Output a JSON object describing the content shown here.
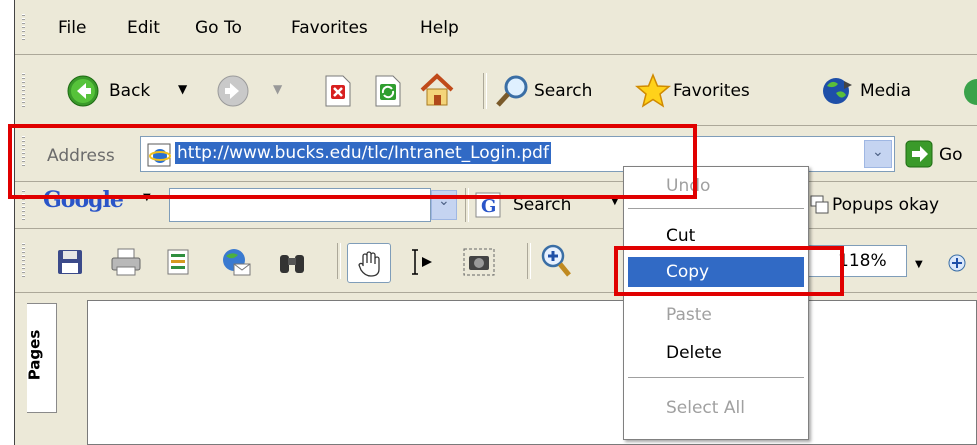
{
  "menubar": {
    "items": [
      {
        "label": "File"
      },
      {
        "label": "Edit"
      },
      {
        "label": "Go To"
      },
      {
        "label": "Favorites"
      },
      {
        "label": "Help"
      }
    ]
  },
  "toolbar": {
    "back_label": "Back",
    "search_label": "Search",
    "favorites_label": "Favorites",
    "media_label": "Media"
  },
  "address": {
    "label": "Address",
    "url": "http://www.bucks.edu/tlc/Intranet_Login.pdf",
    "go_label": "Go"
  },
  "google": {
    "logo": "Google",
    "search_label": "Search",
    "popups_label": "Popups okay"
  },
  "pdf_toolbar": {
    "zoom": "118%"
  },
  "sidebar": {
    "pages_tab": "Pages"
  },
  "context_menu": {
    "items": [
      {
        "label": "Undo",
        "enabled": false
      },
      {
        "label": "Cut",
        "enabled": true
      },
      {
        "label": "Copy",
        "enabled": true,
        "selected": true
      },
      {
        "label": "Paste",
        "enabled": false
      },
      {
        "label": "Delete",
        "enabled": true
      },
      {
        "label": "Select All",
        "enabled": false
      }
    ]
  },
  "colors": {
    "chrome": "#ece9d8",
    "selection": "#316ac5",
    "highlight_box": "#e00000"
  }
}
